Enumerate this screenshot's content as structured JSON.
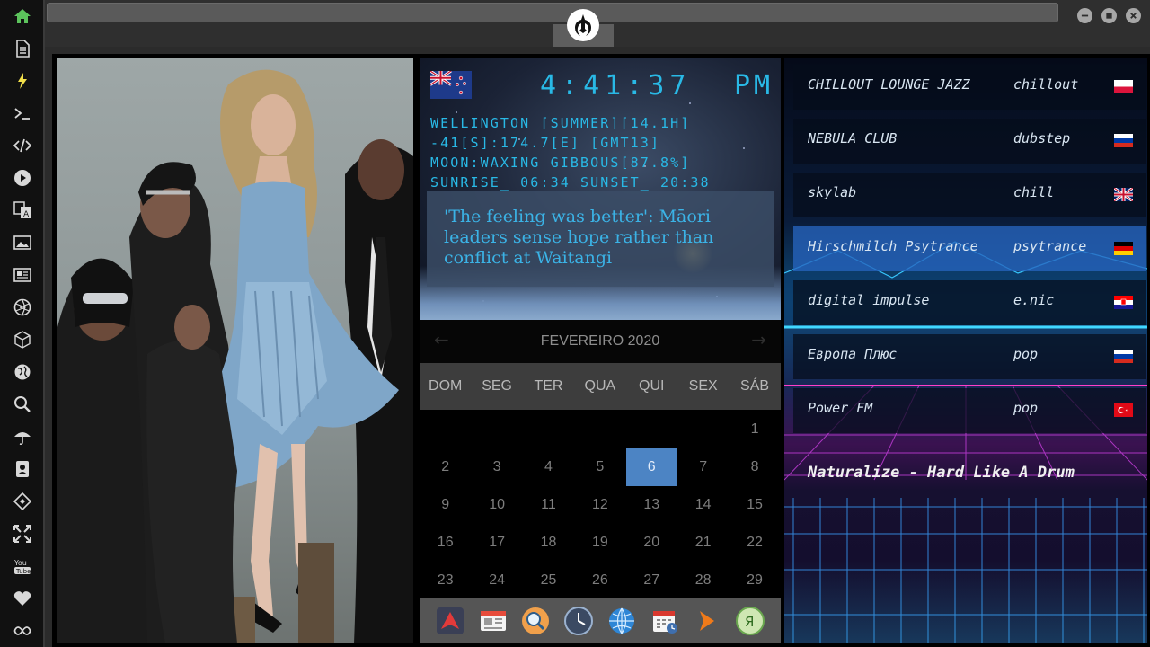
{
  "sidebar": {
    "items": [
      {
        "icon": "home-icon",
        "color": "#5cc35c"
      },
      {
        "icon": "document-icon",
        "color": "#d8d8d8"
      },
      {
        "icon": "lightning-icon",
        "color": "#f2e04a"
      },
      {
        "icon": "terminal-icon",
        "color": "#d8d8d8"
      },
      {
        "icon": "code-icon",
        "color": "#d8d8d8"
      },
      {
        "icon": "play-icon",
        "color": "#d8d8d8"
      },
      {
        "icon": "translate-icon",
        "color": "#d8d8d8"
      },
      {
        "icon": "image-icon",
        "color": "#d8d8d8"
      },
      {
        "icon": "news-icon",
        "color": "#d8d8d8"
      },
      {
        "icon": "aperture-icon",
        "color": "#d8d8d8"
      },
      {
        "icon": "cube-icon",
        "color": "#d8d8d8"
      },
      {
        "icon": "globe-icon",
        "color": "#d8d8d8"
      },
      {
        "icon": "search-icon",
        "color": "#d8d8d8"
      },
      {
        "icon": "umbrella-icon",
        "color": "#d8d8d8"
      },
      {
        "icon": "contacts-icon",
        "color": "#d8d8d8"
      },
      {
        "icon": "tag-icon",
        "color": "#d8d8d8"
      },
      {
        "icon": "expand-icon",
        "color": "#d8d8d8"
      },
      {
        "icon": "youtube-icon",
        "color": "#d8d8d8"
      },
      {
        "icon": "heart-icon",
        "color": "#d8d8d8"
      },
      {
        "icon": "infinity-icon",
        "color": "#d8d8d8"
      }
    ]
  },
  "titlebar": {
    "logo_icon": "rebel-alliance-icon",
    "controls": [
      "minimize-icon",
      "maximize-icon",
      "close-icon"
    ]
  },
  "clock": {
    "flag": "new-zealand-flag",
    "time": "4:41:37",
    "ampm": "PM",
    "location": "WELLINGTON [SUMMER][14.1H]",
    "coords": "-41[S]:174.7[E] [GMT13]",
    "moon": "MOON:WAXING GIBBOUS[87.8%]",
    "sun": "SUNRISE_ 06:34 SUNSET_ 20:38",
    "color": "#29b9e6"
  },
  "news": {
    "headline": "'The feeling was better': Māori leaders sense hope rather than conflict at Waitangi"
  },
  "calendar": {
    "month": "FEVEREIRO 2020",
    "prev": "←",
    "next": "→",
    "weekdays": [
      "DOM",
      "SEG",
      "TER",
      "QUA",
      "QUI",
      "SEX",
      "SÁB"
    ],
    "weeks": [
      [
        "",
        "",
        "",
        "",
        "",
        "",
        "1"
      ],
      [
        "2",
        "3",
        "4",
        "5",
        "6",
        "7",
        "8"
      ],
      [
        "9",
        "10",
        "11",
        "12",
        "13",
        "14",
        "15"
      ],
      [
        "16",
        "17",
        "18",
        "19",
        "20",
        "21",
        "22"
      ],
      [
        "23",
        "24",
        "25",
        "26",
        "27",
        "28",
        "29"
      ]
    ],
    "today": "6",
    "today_color": "#4c84c4"
  },
  "dock": {
    "apps": [
      "red-app-icon",
      "newspaper-app-icon",
      "search-app-icon",
      "clock-app-icon",
      "globe-app-icon",
      "calendar-app-icon",
      "arrow-app-icon",
      "yandex-app-icon"
    ]
  },
  "radio": {
    "stations": [
      {
        "name": "CHILLOUT LOUNGE JAZZ",
        "genre": "chillout",
        "flag": "poland-flag",
        "selected": false
      },
      {
        "name": "NEBULA CLUB",
        "genre": "dubstep",
        "flag": "russia-flag",
        "selected": false
      },
      {
        "name": "skylab",
        "genre": "chill",
        "flag": "uk-flag",
        "selected": false
      },
      {
        "name": "Hirschmilch Psytrance",
        "genre": "psytrance",
        "flag": "germany-flag",
        "selected": true
      },
      {
        "name": "digital impulse",
        "genre": "e.nic",
        "flag": "croatia-flag",
        "selected": false
      },
      {
        "name": "Европа Плюс",
        "genre": "pop",
        "flag": "russia-flag",
        "selected": false
      },
      {
        "name": "Power FM",
        "genre": "pop",
        "flag": "turkey-flag",
        "selected": false
      }
    ],
    "now_playing": "Naturalize - Hard Like A Drum",
    "selected_color": "#2664be"
  }
}
